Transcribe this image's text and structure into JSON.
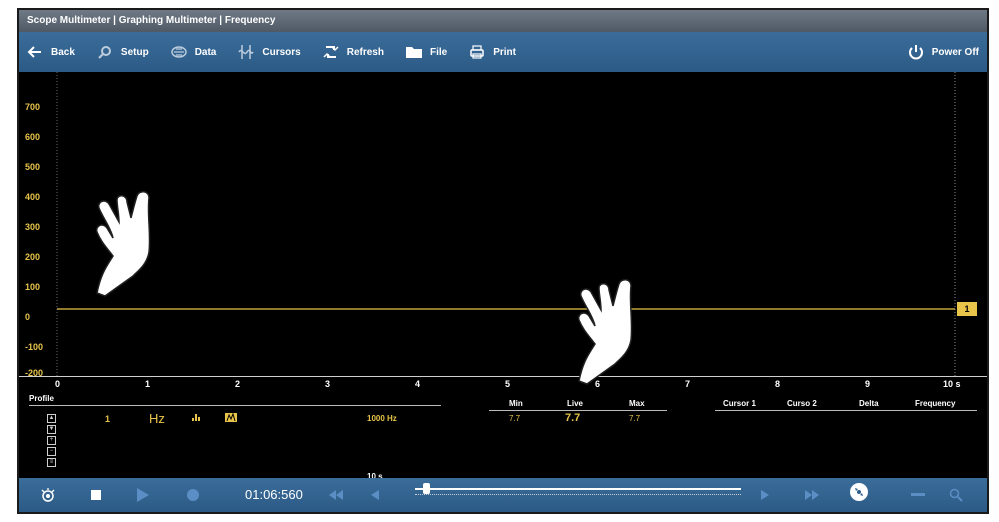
{
  "window": {
    "title": "Scope Multimeter | Graphing Multimeter | Frequency"
  },
  "toolbar": {
    "back": "Back",
    "setup": "Setup",
    "data": "Data",
    "cursors": "Cursors",
    "refresh": "Refresh",
    "file": "File",
    "print": "Print",
    "power_off": "Power Off"
  },
  "graph": {
    "y_ticks": [
      "700",
      "600",
      "500",
      "400",
      "300",
      "200",
      "100",
      "0",
      "-100",
      "-200"
    ],
    "x_ticks": [
      "0",
      "1",
      "2",
      "3",
      "4",
      "5",
      "6",
      "7",
      "8",
      "9",
      "10 s"
    ],
    "cursor_flag": "1",
    "trace_color": "#e8c44a"
  },
  "panel": {
    "profile_label": "Profile",
    "channel_number": "1",
    "unit": "Hz",
    "scale": "1000 Hz",
    "time_scale": "10 s",
    "stats": {
      "min_label": "Min",
      "live_label": "Live",
      "max_label": "Max",
      "min_value": "7.7",
      "live_value": "7.7",
      "max_value": "7.7"
    },
    "cursor_cols": {
      "cursor1": "Cursor 1",
      "cursor2": "Curso 2",
      "delta": "Delta",
      "frequency": "Frequency"
    }
  },
  "playback": {
    "time": "01:06:560"
  },
  "colors": {
    "accent": "#e8c44a",
    "bar": "#2f5f8c"
  }
}
